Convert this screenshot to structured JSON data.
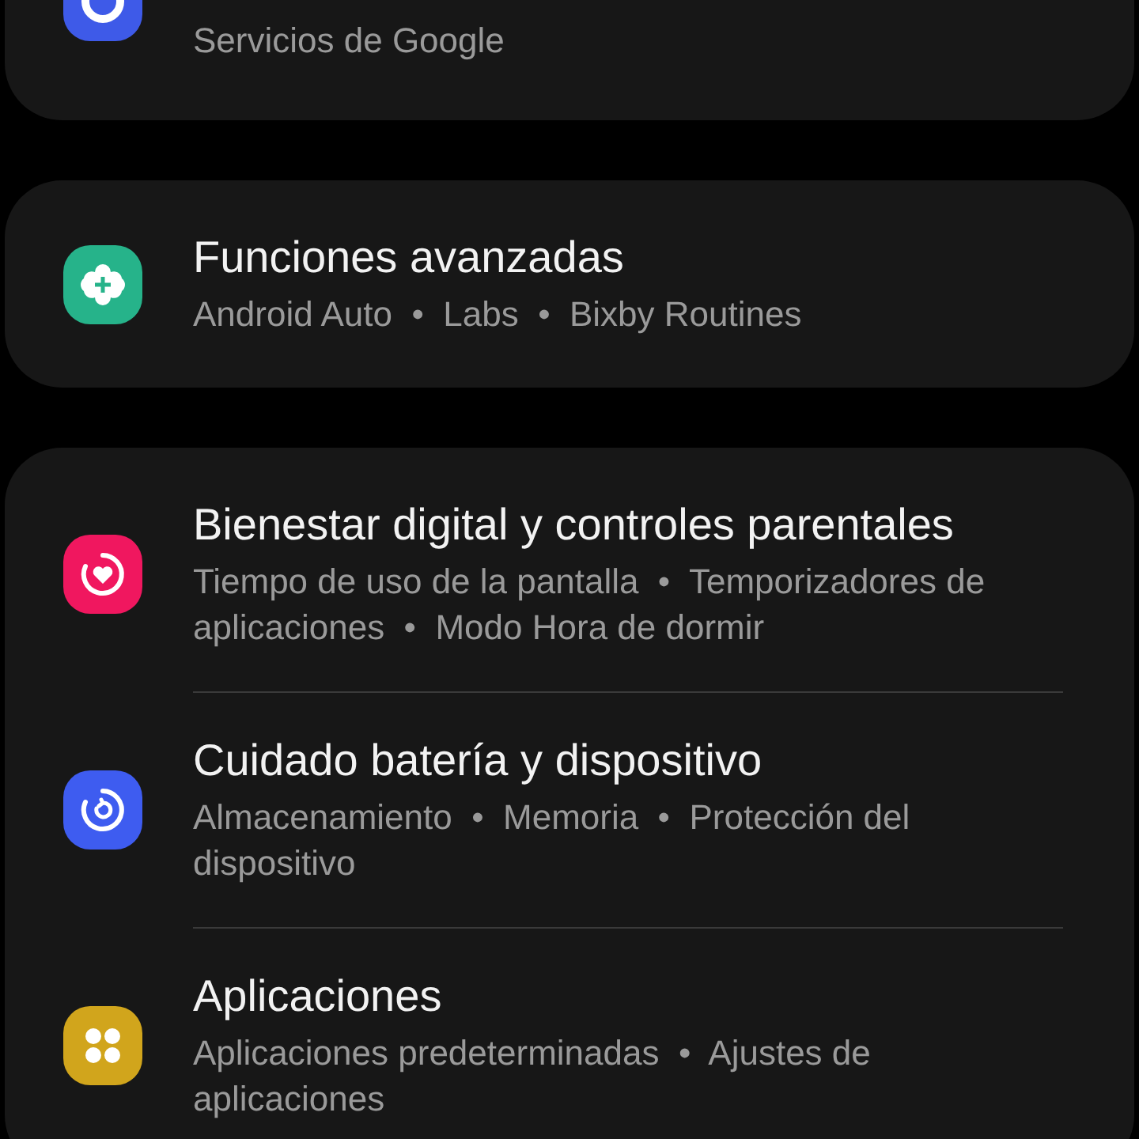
{
  "groups": [
    {
      "items": [
        {
          "kind": "ring",
          "color": "#3e5ae8",
          "subtitle": "Servicios de Google",
          "clipped": true
        }
      ]
    },
    {
      "items": [
        {
          "kind": "gear",
          "color": "#26b38a",
          "title": "Funciones avanzadas",
          "subtitle": "Android Auto  •  Labs  •  Bixby Routines"
        }
      ]
    },
    {
      "items": [
        {
          "kind": "heart",
          "color": "#f0175f",
          "title": "Bienestar digital y controles parentales",
          "subtitle": "Tiempo de uso de la pantalla  •  Temporizadores de aplicaciones  •  Modo Hora de dormir"
        },
        {
          "kind": "care",
          "color": "#3e5cf0",
          "title": "Cuidado batería y dispositivo",
          "subtitle": "Almacenamiento  •  Memoria  •  Protección del dispositivo"
        },
        {
          "kind": "apps",
          "color": "#d1a51c",
          "title": "Aplicaciones",
          "subtitle": "Aplicaciones predeterminadas  •  Ajustes de aplicaciones"
        }
      ]
    }
  ]
}
